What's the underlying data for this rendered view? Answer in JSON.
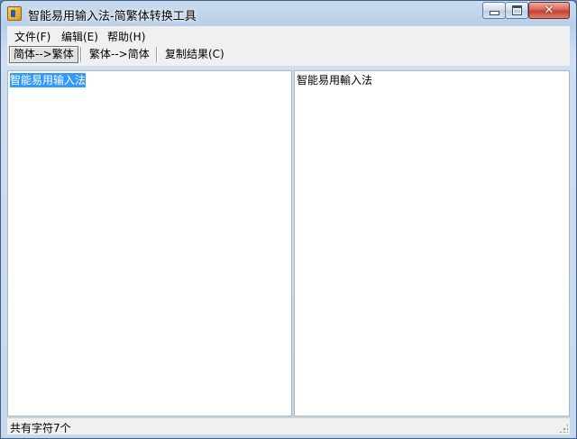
{
  "window": {
    "title": "智能易用输入法-简繁体转换工具",
    "icon": "app-icon"
  },
  "caption_buttons": {
    "minimize_icon": "minimize-icon",
    "maximize_icon": "maximize-icon",
    "close_icon": "close-icon",
    "close_glyph": "✕"
  },
  "menubar": {
    "items": [
      {
        "label": "文件(F)"
      },
      {
        "label": "编辑(E)"
      },
      {
        "label": "帮助(H)"
      }
    ]
  },
  "toolbar": {
    "buttons": [
      {
        "label": "简体-->繁体",
        "pressed": true
      },
      {
        "label": "繁体-->简体",
        "pressed": false
      },
      {
        "label": "复制结果(C)",
        "pressed": false
      }
    ]
  },
  "editor": {
    "source_text": "智能易用输入法",
    "result_text": "智能易用輸入法"
  },
  "statusbar": {
    "text": "共有字符7个"
  },
  "colors": {
    "selection": "#3399ff",
    "close_button": "#c5402f",
    "chrome": "#c9dbee"
  }
}
